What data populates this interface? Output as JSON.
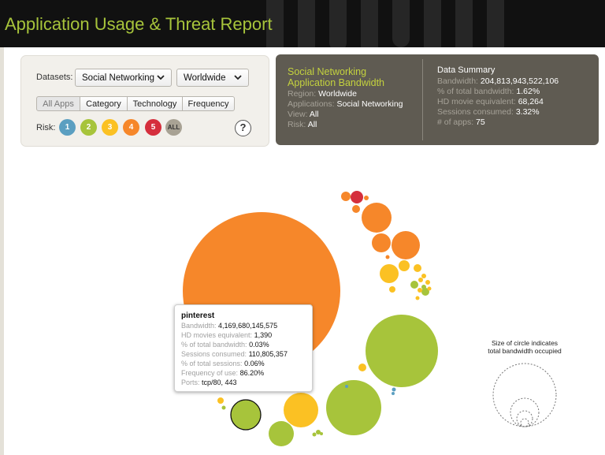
{
  "header": {
    "title": "Application Usage & Threat Report"
  },
  "filters": {
    "datasets_label": "Datasets:",
    "dataset_value": "Social Networking",
    "region_value": "Worldwide",
    "tabs": [
      {
        "label": "All Apps",
        "active": true
      },
      {
        "label": "Category",
        "active": false
      },
      {
        "label": "Technology",
        "active": false
      },
      {
        "label": "Frequency",
        "active": false
      }
    ],
    "risk_label": "Risk:",
    "risk_levels": [
      {
        "label": "1",
        "color": "#5b9fc1"
      },
      {
        "label": "2",
        "color": "#a7c43b"
      },
      {
        "label": "3",
        "color": "#fbc123"
      },
      {
        "label": "4",
        "color": "#f6872a"
      },
      {
        "label": "5",
        "color": "#d52f3d"
      },
      {
        "label": "ALL",
        "color": "#a8a294"
      }
    ],
    "help": "?"
  },
  "selection": {
    "title_line1": "Social Networking",
    "title_line2": "Application Bandwidth",
    "rows": [
      {
        "key": "Region:",
        "value": "Worldwide"
      },
      {
        "key": "Applications:",
        "value": "Social Networking"
      },
      {
        "key": "View:",
        "value": "All"
      },
      {
        "key": "Risk:",
        "value": "All"
      }
    ]
  },
  "summary": {
    "title": "Data Summary",
    "rows": [
      {
        "key": "Bandwidth:",
        "value": "204,813,943,522,106"
      },
      {
        "key": "% of total bandwidth:",
        "value": "1.62%"
      },
      {
        "key": "HD movie equivalent:",
        "value": "68,264"
      },
      {
        "key": "Sessions consumed:",
        "value": "3.32%"
      },
      {
        "key": "# of apps:",
        "value": "75"
      }
    ]
  },
  "tooltip": {
    "title": "pinterest",
    "rows": [
      {
        "key": "Bandwidth:",
        "value": "4,169,680,145,575"
      },
      {
        "key": "HD movies equivalent:",
        "value": "1,390"
      },
      {
        "key": "% of total bandwidth:",
        "value": "0.03%"
      },
      {
        "key": "Sessions consumed:",
        "value": "110,805,357"
      },
      {
        "key": "% of total sessions:",
        "value": "0.06%"
      },
      {
        "key": "Frequency of use:",
        "value": "86.20%"
      },
      {
        "key": "Ports:",
        "value": "tcp/80,  443"
      }
    ]
  },
  "legend": {
    "line1": "Size of circle indicates",
    "line2": "total bandwidth occupied"
  },
  "icons": {
    "dropdown": "chevron-down-icon",
    "help": "help-icon"
  },
  "colors": {
    "risk1": "#5b9fc1",
    "risk2": "#a7c43b",
    "risk3": "#fbc123",
    "risk4": "#f6872a",
    "risk5": "#d52f3d",
    "accent": "#a7c43b"
  }
}
